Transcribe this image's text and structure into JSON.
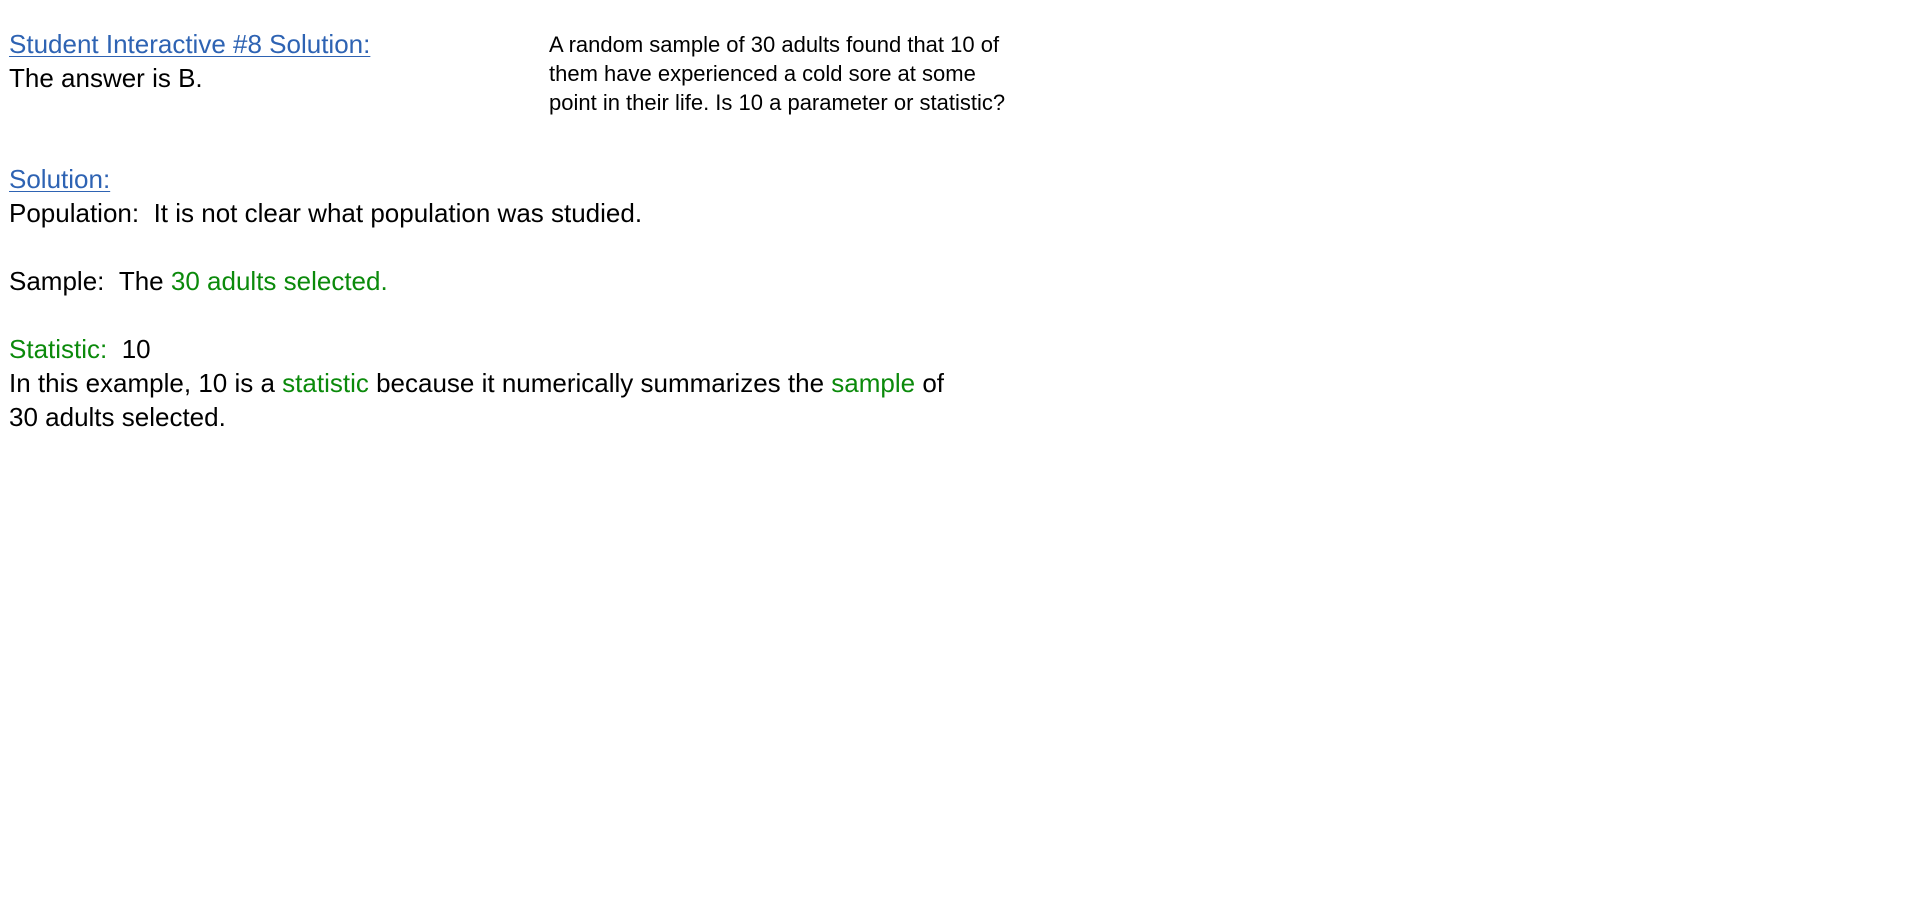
{
  "header": {
    "title": "Student Interactive #8 Solution:",
    "answer": "The answer is B."
  },
  "question": {
    "lines": [
      "A random sample of 30 adults found that 10 of",
      "them have experienced a cold sore at some",
      "point in their life.  Is 10 a parameter or statistic?"
    ]
  },
  "solution": {
    "heading": "Solution:",
    "population_label": "Population:",
    "population_text": "It is not clear what population was studied.",
    "sample_label": "Sample:",
    "sample_prefix": "The",
    "sample_value": "30 adults selected.",
    "statistic_label": "Statistic:",
    "statistic_value": "10",
    "explanation": {
      "part1": "In this example, 10 is a",
      "term1": "statistic",
      "part2": "because it numerically summarizes the",
      "term2": "sample",
      "part3": "of",
      "line2": "30 adults selected."
    }
  },
  "colors": {
    "link": "#2e63b3",
    "highlight": "#0b8a0b",
    "text": "#000000"
  }
}
